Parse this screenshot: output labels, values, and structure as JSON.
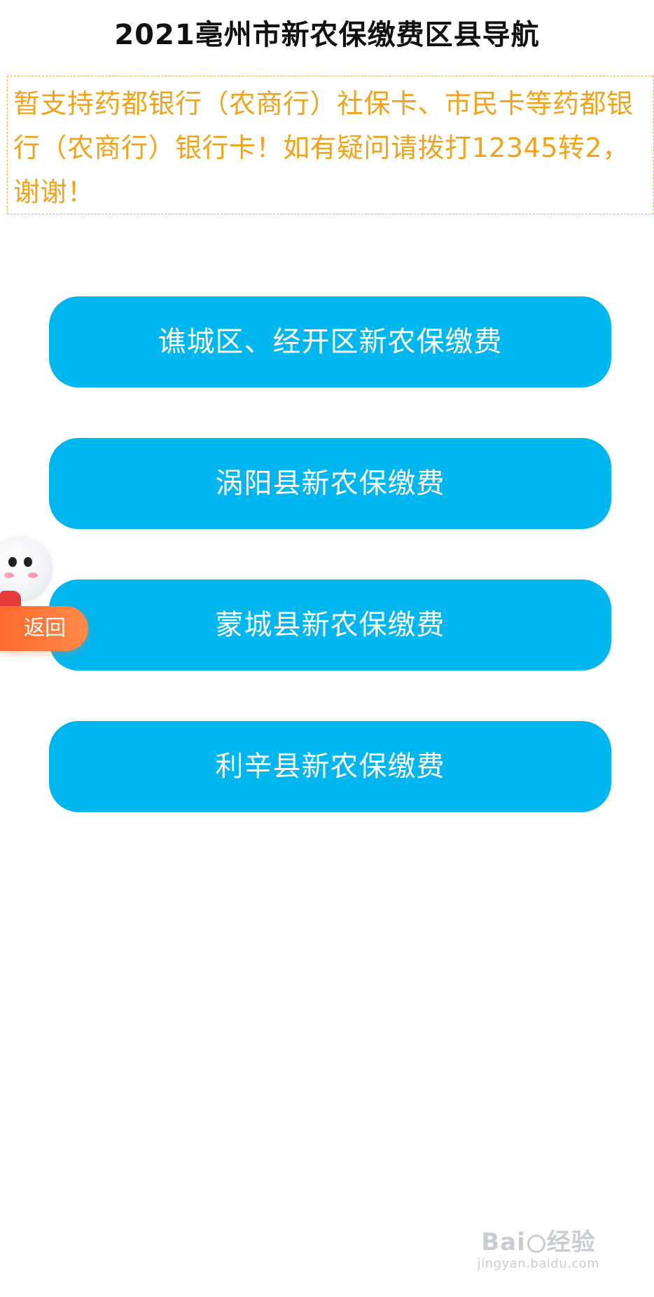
{
  "header": {
    "title": "2021亳州市新农保缴费区县导航"
  },
  "notice": {
    "text": "暂支持药都银行（农商行）社保卡、市民卡等药都银行（农商行）银行卡！如有疑问请拨打12345转2，谢谢！",
    "color": "#f0a31c"
  },
  "nav": {
    "button_color": "#00b6ef",
    "items": [
      {
        "label": "谯城区、经开区新农保缴费"
      },
      {
        "label": "涡阳县新农保缴费"
      },
      {
        "label": "蒙城县新农保缴费"
      },
      {
        "label": "利辛县新农保缴费"
      }
    ]
  },
  "float_widget": {
    "back_label": "返回",
    "mascot_icon": "robot-mascot-icon",
    "accent": "#ff6a2c"
  },
  "watermark": {
    "logo_text_left": "Bai",
    "logo_text_right": "经验",
    "url": "jingyan.baidu.com",
    "icon": "baidu-paw-icon"
  }
}
